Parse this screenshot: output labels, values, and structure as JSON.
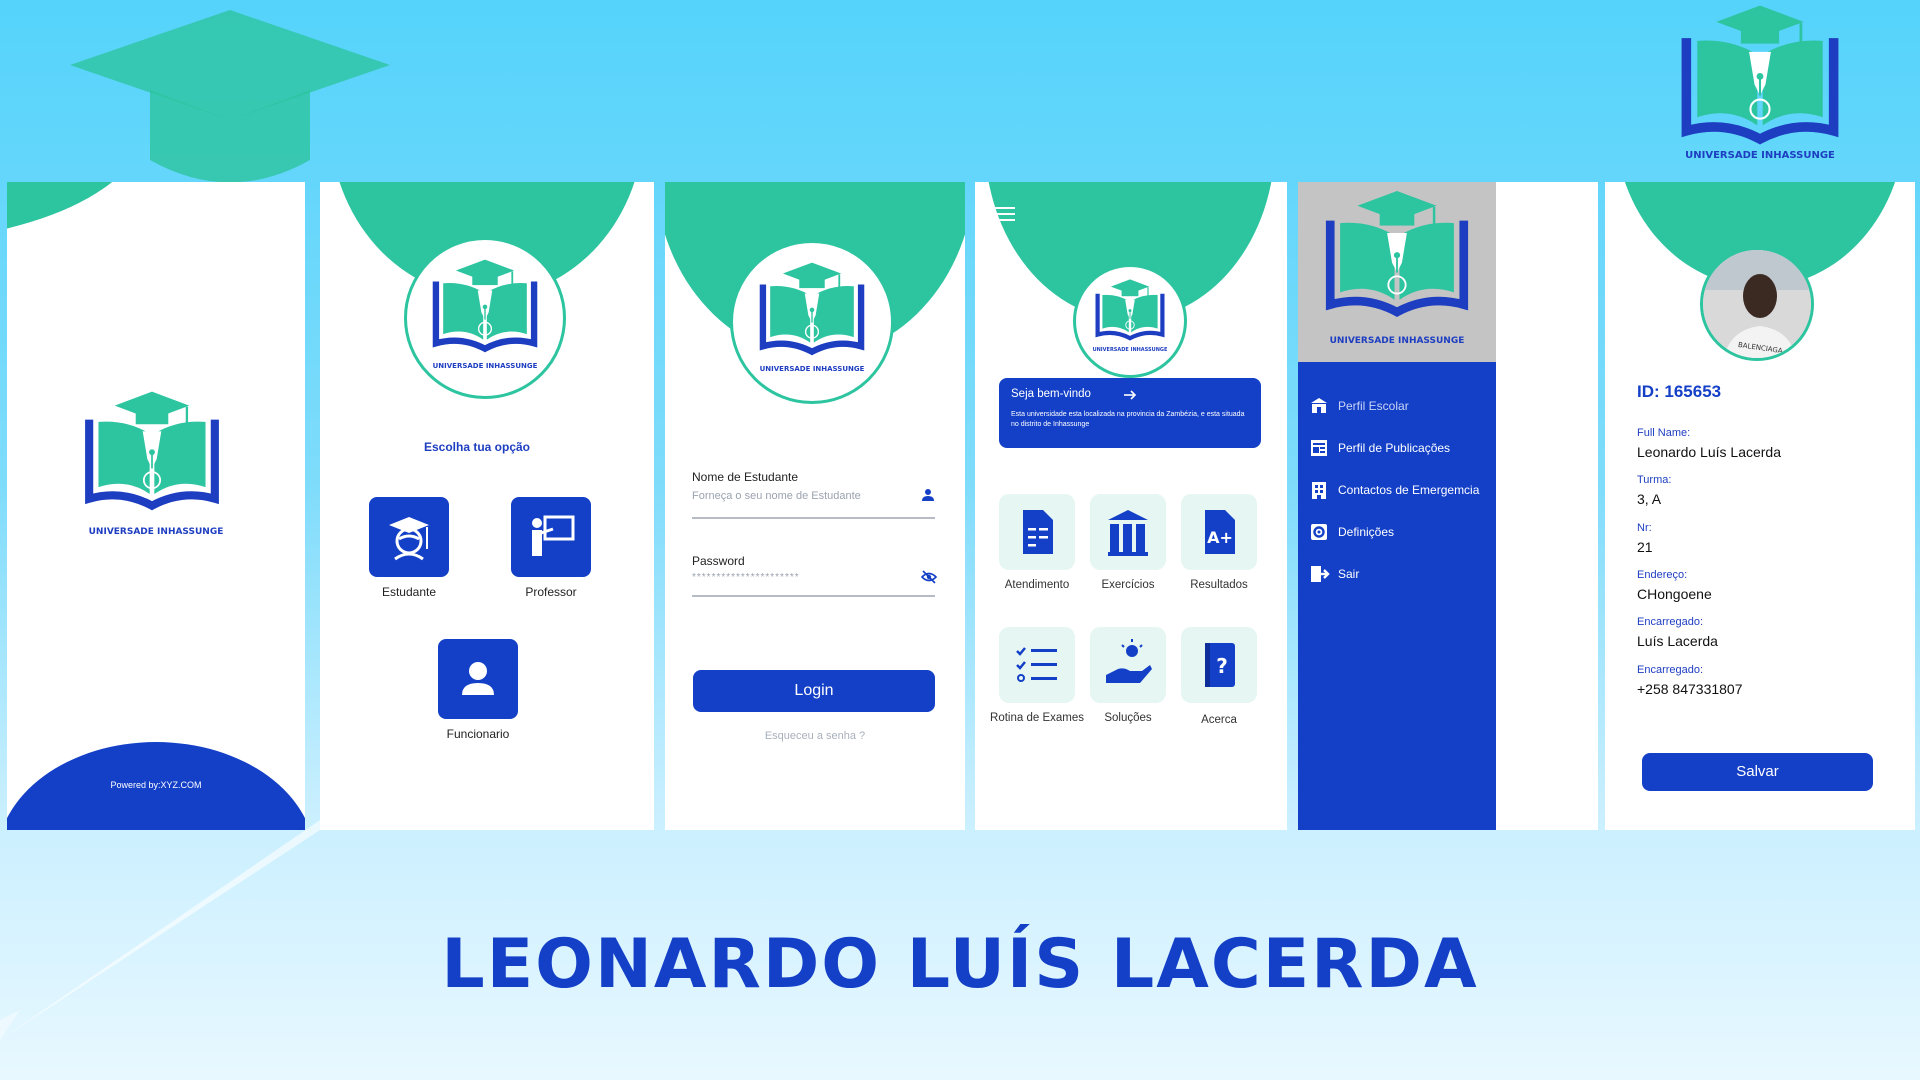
{
  "brand": {
    "university_name": "UNIVERSADE INHASSUNGE",
    "teal": "#2dc4a0",
    "blue": "#1440c8"
  },
  "splash": {
    "powered_by": "Powered by:XYZ.COM"
  },
  "choose": {
    "heading": "Escolha tua opção",
    "options": [
      {
        "label": "Estudante",
        "icon": "student-graduate-icon"
      },
      {
        "label": "Professor",
        "icon": "teacher-board-icon"
      },
      {
        "label": "Funcionario",
        "icon": "user-icon"
      }
    ]
  },
  "login": {
    "username_label": "Nome de Estudante",
    "username_placeholder": "Forneça o seu nome de Estudante",
    "password_label": "Password",
    "password_value": "**********************",
    "login_button": "Login",
    "forgot_link": "Esqueceu a senha ?"
  },
  "home": {
    "welcome_title": "Seja bem-vindo",
    "welcome_text": "Esta universidade esta localizada na provincia da Zambézia, e esta situada no distrito de Inhassunge",
    "tiles": [
      {
        "label": "Atendimento",
        "icon": "document-checklist-icon"
      },
      {
        "label": "Exercícios",
        "icon": "library-books-icon"
      },
      {
        "label": "Resultados",
        "icon": "grade-a-plus-icon"
      },
      {
        "label": "Rotina de Exames",
        "icon": "list-check-icon"
      },
      {
        "label": "Soluções",
        "icon": "idea-hand-icon"
      },
      {
        "label": "Acerca",
        "icon": "question-book-icon"
      }
    ]
  },
  "menu": {
    "items": [
      {
        "label": "Perfil Escolar",
        "icon": "school-icon"
      },
      {
        "label": "Perfil de Publicações",
        "icon": "newspaper-icon"
      },
      {
        "label": "Contactos de Emergemcia",
        "icon": "building-contacts-icon"
      },
      {
        "label": "Definições",
        "icon": "settings-icon"
      },
      {
        "label": "Sair",
        "icon": "logout-icon"
      }
    ]
  },
  "profile": {
    "id_label": "ID: 165653",
    "fields": [
      {
        "label": "Full Name:",
        "value": "Leonardo Luís Lacerda"
      },
      {
        "label": "Turma:",
        "value": "3, A"
      },
      {
        "label": "Nr:",
        "value": "21"
      },
      {
        "label": "Endereço:",
        "value": "CHongoene"
      },
      {
        "label": "Encarregado:",
        "value": "Luís Lacerda"
      },
      {
        "label": "Encarregado:",
        "value": "+258 847331807"
      }
    ],
    "save_button": "Salvar",
    "photo_text": "BALENCIAGA"
  },
  "footer": {
    "name": "LEONARDO LUÍS LACERDA"
  }
}
